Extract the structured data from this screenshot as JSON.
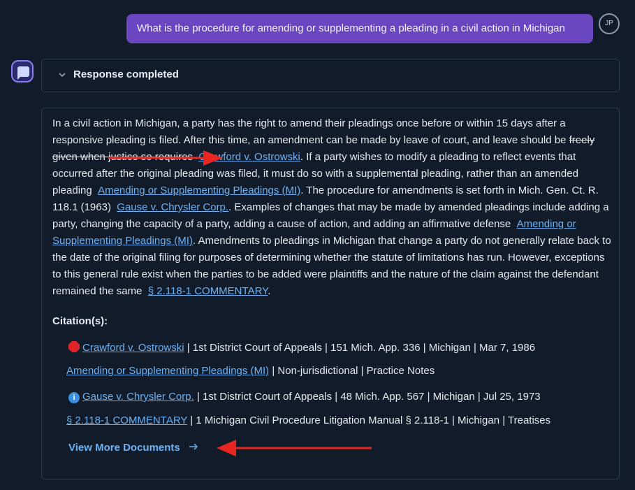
{
  "user_message": {
    "text": "What is the procedure for amending or supplementing a pleading in a civil action in Michigan",
    "avatar_initials": "JP"
  },
  "status": {
    "label": "Response completed"
  },
  "answer": {
    "p1": "In a civil action in Michigan, a party has the right to amend their pleadings once before or within 15 days after a responsive pleading is filed. After this time, an amendment can be made by leave of court, and leave should be ",
    "p1_strike": "freely given when justice so requires",
    "link1": "Crawford v. Ostrowski",
    "p2": ". If a party wishes to modify a pleading to reflect events that occurred after the original pleading was filed, it must do so with a supplemental pleading, rather than an amended pleading ",
    "link2": "Amending or Supplementing Pleadings (MI)",
    "p3": ". The procedure for amendments is set forth in Mich. Gen. Ct. R. 118.1 (1963) ",
    "link3": "Gause v. Chrysler Corp.",
    "p4": ". Examples of changes that may be made by amended pleadings include adding a party, changing the capacity of a party, adding a cause of action, and adding an affirmative defense ",
    "link4": "Amending or Supplementing Pleadings (MI)",
    "p5": ". Amendments to pleadings in Michigan that change a party do not generally relate back to the date of the original filing for purposes of determining whether the statute of limitations has run. However, exceptions to this general rule exist when the parties to be added were plaintiffs and the nature of the claim against the defendant remained the same ",
    "link5": "§ 2.118-1 COMMENTARY",
    "p6": "."
  },
  "citations": {
    "heading": "Citation(s):",
    "items": [
      {
        "title": "Crawford v. Ostrowski",
        "details": " | 1st District Court of Appeals | 151 Mich. App. 336 | Michigan | Mar 7, 1986",
        "flag": "red-stop"
      },
      {
        "title": "Amending or Supplementing Pleadings (MI)",
        "details": " | Non-jurisdictional | Practice Notes",
        "flag": "none"
      },
      {
        "title": "Gause v. Chrysler Corp.",
        "details": " | 1st District Court of Appeals | 48 Mich. App. 567 | Michigan | Jul 25, 1973",
        "flag": "blue-info",
        "flag_glyph": "i"
      },
      {
        "title": "§ 2.118-1 COMMENTARY",
        "details": " | 1 Michigan Civil Procedure Litigation Manual § 2.118-1 | Michigan | Treatises",
        "flag": "none"
      }
    ],
    "view_more": "View More Documents"
  },
  "colors": {
    "background": "#111b29",
    "user_bubble": "#6b46c1",
    "link": "#6ab2f5",
    "annotation_arrow": "#e8251f",
    "flag_red": "#e0242a",
    "flag_blue": "#3b8fe0"
  }
}
